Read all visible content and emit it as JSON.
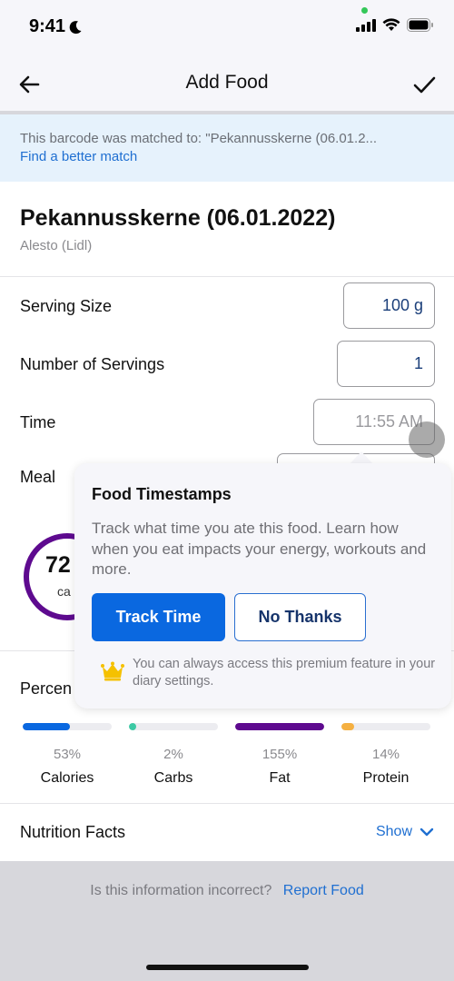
{
  "status_bar": {
    "time": "9:41",
    "focus_icon": "moon-icon",
    "icons": [
      "cellular-signal-icon",
      "wifi-icon",
      "battery-icon"
    ]
  },
  "nav": {
    "title": "Add Food",
    "back_icon": "back-arrow-icon",
    "confirm_icon": "checkmark-icon"
  },
  "banner": {
    "text": "This barcode was matched to: \"Pekannusskerne (06.01.2...",
    "link": "Find a better match"
  },
  "food": {
    "name": "Pekannusskerne (06.01.2022)",
    "brand": "Alesto (Lidl)"
  },
  "form": {
    "serving_size_label": "Serving Size",
    "serving_size_value": "100 g",
    "servings_label": "Number of Servings",
    "servings_value": "1",
    "time_label": "Time",
    "time_value": "11:55 AM",
    "meal_label": "Meal"
  },
  "calories": {
    "value_visible": "72",
    "unit_visible": "ca",
    "ring_color": "#5e0a8f"
  },
  "percent": {
    "label_visible": "Percen",
    "macros": [
      {
        "name": "Calories",
        "percent": "53%",
        "fill_fraction": 0.53,
        "color": "#0a68e0"
      },
      {
        "name": "Carbs",
        "percent": "2%",
        "fill_fraction": 0.02,
        "color": "#3cc9a4"
      },
      {
        "name": "Fat",
        "percent": "155%",
        "fill_fraction": 1.0,
        "color": "#5e0a8f"
      },
      {
        "name": "Protein",
        "percent": "14%",
        "fill_fraction": 0.14,
        "color": "#f5b041"
      }
    ]
  },
  "nutrition_facts": {
    "label": "Nutrition Facts",
    "toggle": "Show"
  },
  "footer": {
    "question": "Is this information incorrect?",
    "link": "Report Food"
  },
  "popover": {
    "title": "Food Timestamps",
    "body": "Track what time you ate this food. Learn how when you eat impacts your energy, workouts and more.",
    "primary_button": "Track Time",
    "secondary_button": "No Thanks",
    "note": "You can always access this premium feature in your diary settings.",
    "note_icon": "crown-icon"
  }
}
